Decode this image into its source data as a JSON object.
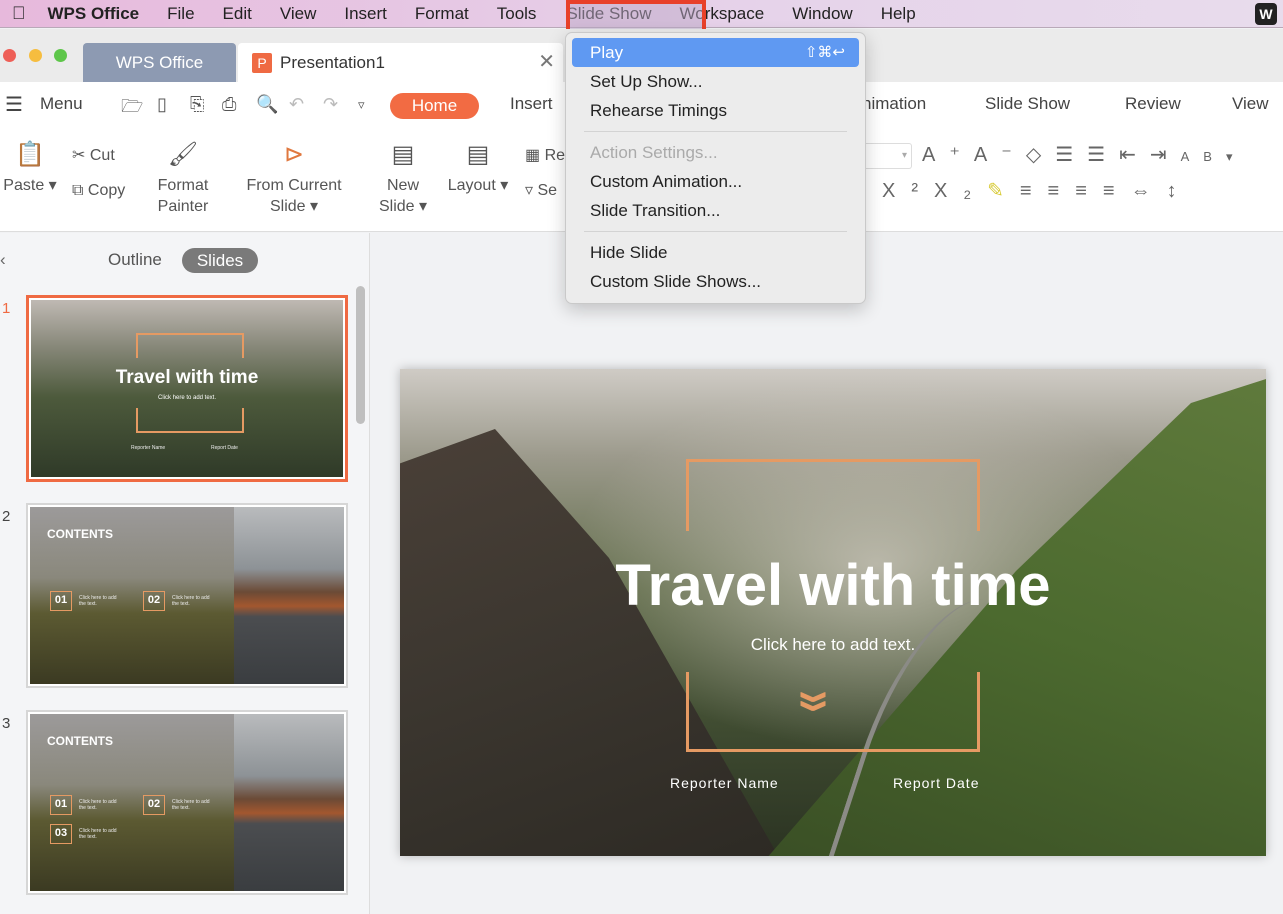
{
  "menubar": {
    "app": "WPS Office",
    "items": [
      "File",
      "Edit",
      "View",
      "Insert",
      "Format",
      "Tools",
      "Slide Show",
      "Workspace",
      "Window",
      "Help"
    ]
  },
  "tabs": {
    "home_tab": "WPS Office",
    "doc_tab": "Presentation1"
  },
  "toolbar": {
    "menu": "Menu",
    "ribbon_tabs": [
      "Home",
      "Insert",
      "nimation",
      "Slide Show",
      "Review",
      "View"
    ],
    "paste": "Paste",
    "cut": "Cut",
    "copy": "Copy",
    "format_painter": [
      "Format",
      "Painter"
    ],
    "from_current": [
      "From Current",
      "Slide"
    ],
    "new_slide": [
      "New",
      "Slide"
    ],
    "layout": "Layout",
    "reset_partial": "Re",
    "section_partial": "Se"
  },
  "dropdown": {
    "items": [
      {
        "label": "Play",
        "shortcut": "⇧⌘↩"
      },
      {
        "label": "Set Up Show..."
      },
      {
        "label": "Rehearse Timings"
      },
      {
        "label": "Action Settings..."
      },
      {
        "label": "Custom Animation..."
      },
      {
        "label": "Slide Transition..."
      },
      {
        "label": "Hide Slide"
      },
      {
        "label": "Custom Slide Shows..."
      }
    ]
  },
  "panel": {
    "outline": "Outline",
    "slides": "Slides"
  },
  "thumbs": [
    {
      "num": "1",
      "title": "Travel with time",
      "sub": "Click here to add text.",
      "reporter": "Reporter Name",
      "date": "Report Date"
    },
    {
      "num": "2",
      "title": "CONTENTS",
      "items": [
        "01",
        "02"
      ],
      "item_text": "Click here to add the text."
    },
    {
      "num": "3",
      "title": "CONTENTS",
      "items": [
        "01",
        "02",
        "03"
      ],
      "item_text": "Click here to add the text."
    }
  ],
  "slide": {
    "title": "Travel with time",
    "subtitle": "Click here to add text.",
    "reporter": "Reporter Name",
    "date": "Report Date"
  },
  "colors": {
    "accent": "#f26b43",
    "menu_highlight": "#5f99f2",
    "frame": "#e59a63",
    "callout": "#e8402a"
  }
}
